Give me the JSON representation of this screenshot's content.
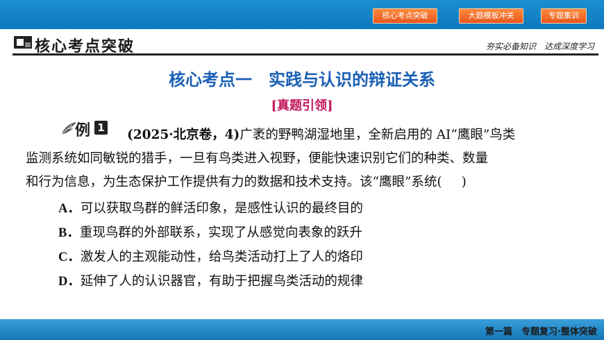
{
  "top_nav": {
    "buttons": [
      "核心考点突破",
      "大题模板冲关",
      "专题集训"
    ]
  },
  "section": {
    "title": "核心考点突破",
    "subtitle": "夯实必备知识　达成深度学习"
  },
  "slide_title": "核心考点一　实践与认识的辩证关系",
  "sub_label": "[真题引领]",
  "example": {
    "label": "例",
    "number": "1",
    "source": "(2025·北京卷，4)",
    "text_line1": "广袤的野鸭湖湿地里，全新启用的 AI“鹰眼”鸟类",
    "text_line2": "监测系统如同敏锐的猎手，一旦有鸟类进入视野，便能快速识别它们的种类、数量",
    "text_line3": "和行为信息，为生态保护工作提供有力的数据和技术支持。该“鹰眼”系统(",
    "text_close": ")"
  },
  "options": [
    {
      "key": "A．",
      "text": "可以获取鸟群的鲜活印象，是感性认识的最终目的"
    },
    {
      "key": "B．",
      "text": "重现鸟群的外部联系，实现了从感觉向表象的跃升"
    },
    {
      "key": "C．",
      "text": "激发人的主观能动性，给鸟类活动打上了人的烙印"
    },
    {
      "key": "D．",
      "text": "延伸了人的认识器官，有助于把握鸟类活动的规律"
    }
  ],
  "footer": "第一篇　专题复习·整体突破",
  "colors": {
    "top_bar": "#1a8fd0",
    "nav_button": "#e8561c",
    "slide_title": "#1a5fb4",
    "sub_label": "#c2185b"
  }
}
